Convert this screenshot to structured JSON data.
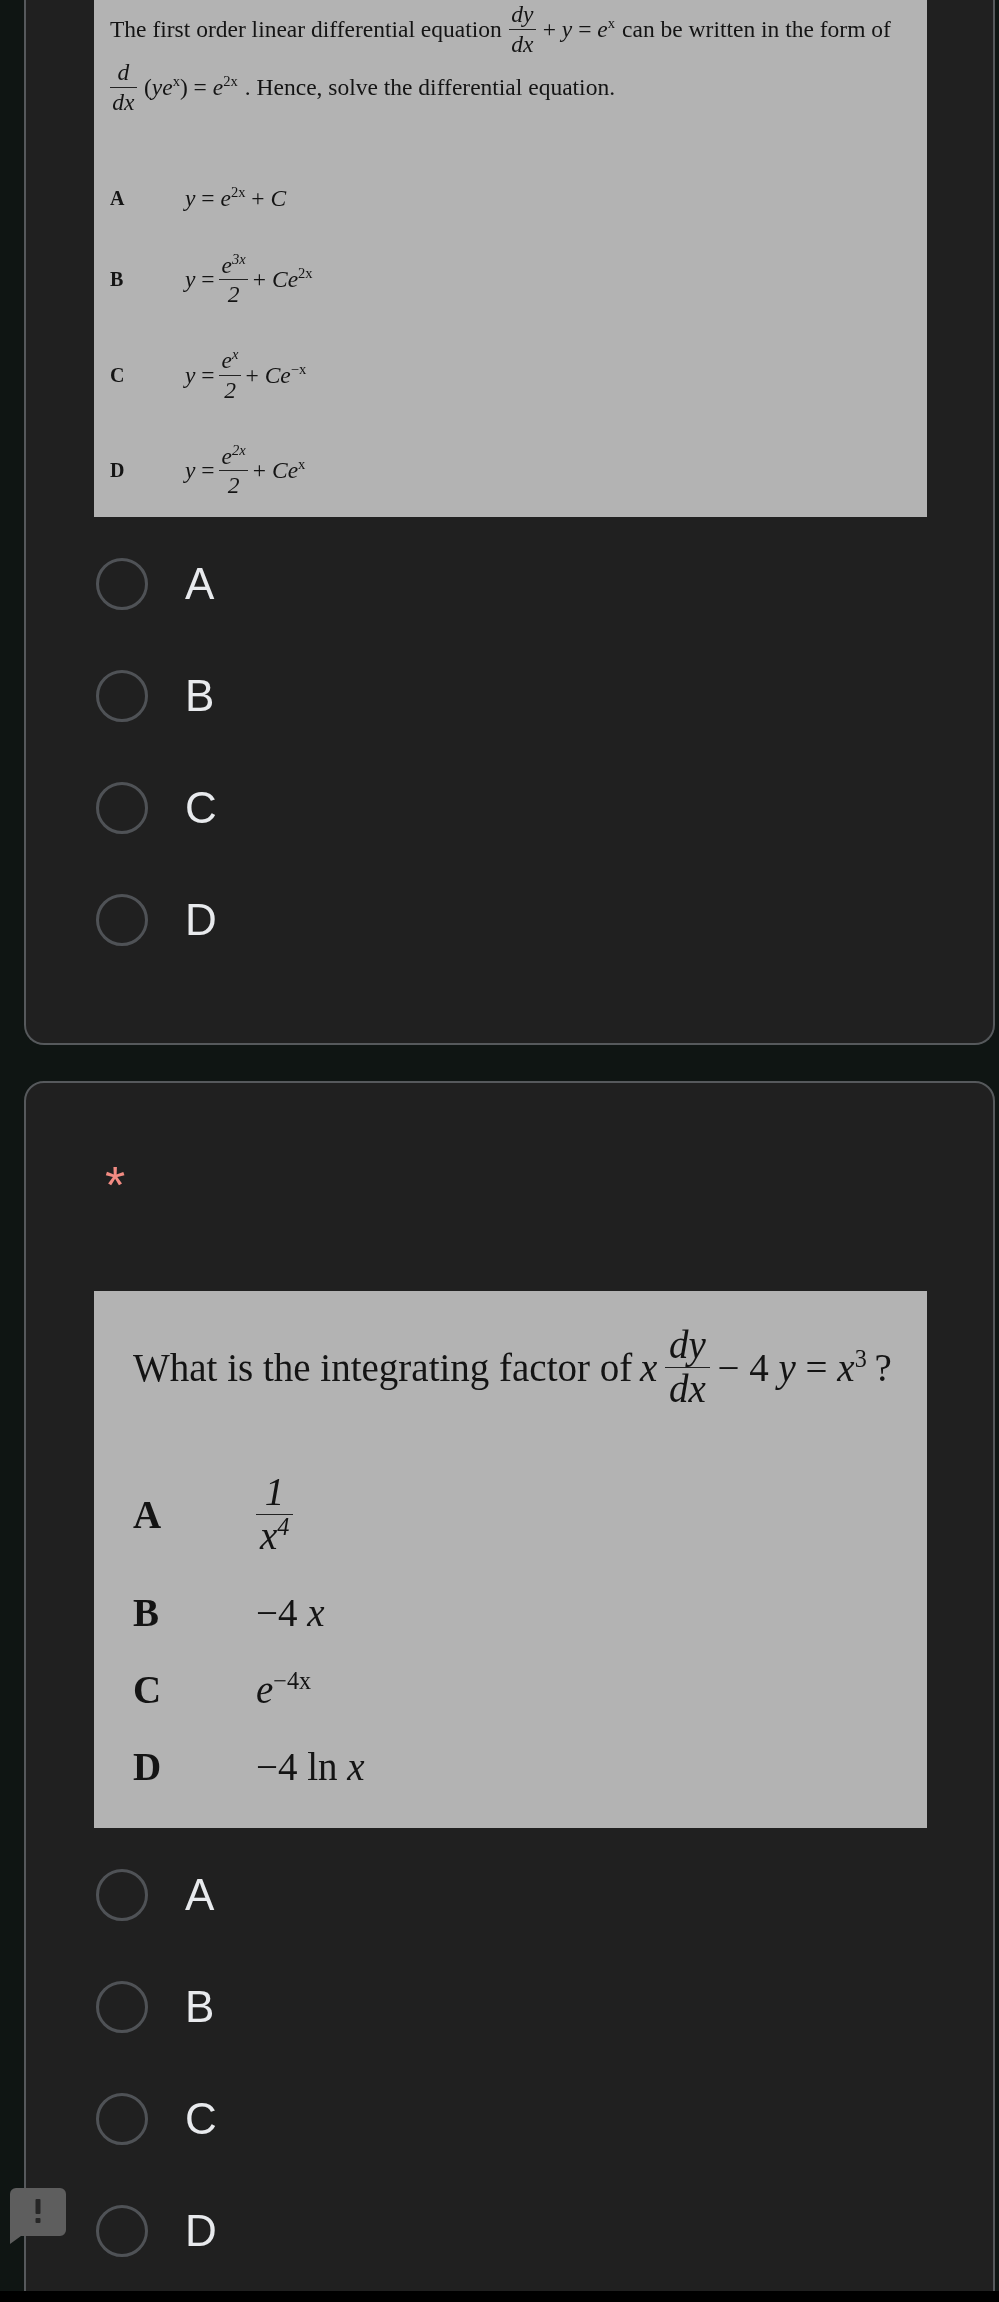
{
  "questions": [
    {
      "image": {
        "prompt": [
          [
            {
              "kind": "text",
              "text": "The first order linear differential equation"
            },
            {
              "kind": "frac",
              "num": "dy",
              "den": "dx"
            },
            {
              "kind": "text",
              "text": "+ *y* = *e*$^{x}$"
            },
            {
              "kind": "text",
              "text": "can be written in the form of"
            }
          ],
          [
            {
              "kind": "frac",
              "num": "d",
              "den": "dx"
            },
            {
              "kind": "text",
              "text": "(*ye*$^{x}$) = *e*$^{2x}$"
            },
            {
              "kind": "text",
              "text": ". Hence, solve the differential equation."
            }
          ]
        ],
        "choices": [
          {
            "letter": "A",
            "expression": [
              {
                "kind": "text",
                "text": "*y* = *e*$^{2x}$ + *C*"
              }
            ]
          },
          {
            "letter": "B",
            "expression": [
              {
                "kind": "text",
                "text": "*y* ="
              },
              {
                "kind": "frac",
                "num": "e$^{3x}$",
                "den": "2"
              },
              {
                "kind": "text",
                "text": "+ *Ce*$^{2x}$"
              }
            ]
          },
          {
            "letter": "C",
            "expression": [
              {
                "kind": "text",
                "text": "*y* ="
              },
              {
                "kind": "frac",
                "num": "e$^{x}$",
                "den": "2"
              },
              {
                "kind": "text",
                "text": "+ *Ce*$^{−x}$"
              }
            ]
          },
          {
            "letter": "D",
            "expression": [
              {
                "kind": "text",
                "text": "*y* ="
              },
              {
                "kind": "frac",
                "num": "e$^{2x}$",
                "den": "2"
              },
              {
                "kind": "text",
                "text": "+ *Ce*$^{x}$"
              }
            ]
          }
        ]
      },
      "options": [
        {
          "label": "A",
          "selected": false
        },
        {
          "label": "B",
          "selected": false
        },
        {
          "label": "C",
          "selected": false
        },
        {
          "label": "D",
          "selected": false
        }
      ]
    },
    {
      "required_mark": "*",
      "image": {
        "prompt": [
          [
            {
              "kind": "text",
              "text": "What is the integrating factor of"
            },
            {
              "kind": "var",
              "text": "x"
            },
            {
              "kind": "frac",
              "num": "dy",
              "den": "dx"
            },
            {
              "kind": "text",
              "text": "− 4 *y* = *x*$^{3}$"
            },
            {
              "kind": "text",
              "text": "?"
            }
          ]
        ],
        "choices": [
          {
            "letter": "A",
            "expression": [
              {
                "kind": "frac",
                "num": "1",
                "den": "x$^{4}$"
              }
            ]
          },
          {
            "letter": "B",
            "expression": [
              {
                "kind": "text",
                "text": "−4 *x*"
              }
            ]
          },
          {
            "letter": "C",
            "expression": [
              {
                "kind": "text",
                "text": "*e*$^{−4x}$"
              }
            ]
          },
          {
            "letter": "D",
            "expression": [
              {
                "kind": "text",
                "text": "−4 ln *x*"
              }
            ]
          }
        ]
      },
      "options": [
        {
          "label": "A",
          "selected": false
        },
        {
          "label": "B",
          "selected": false
        },
        {
          "label": "C",
          "selected": false
        },
        {
          "label": "D",
          "selected": false
        }
      ]
    }
  ]
}
